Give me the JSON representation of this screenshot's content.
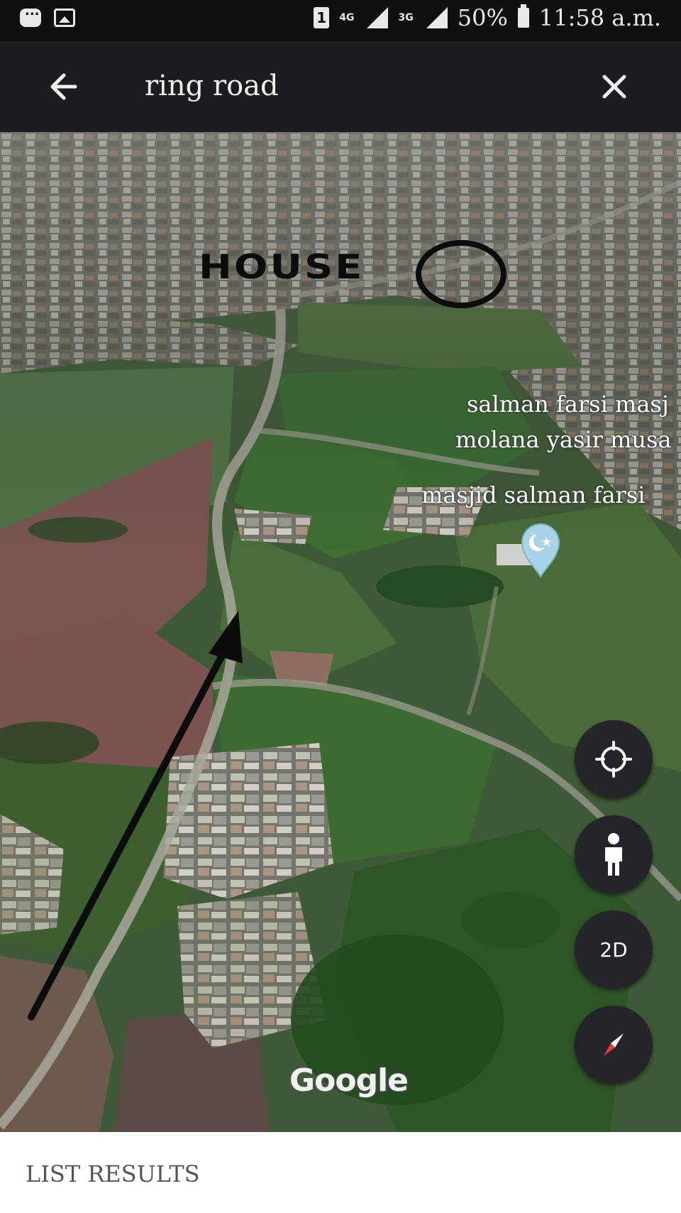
{
  "status_bar": {
    "sim": "1",
    "network_1": "4G",
    "network_2": "3G",
    "battery": "50%",
    "time": "11:58 a.m."
  },
  "app_bar": {
    "query": "ring road",
    "back_icon": "arrow-left-icon",
    "close_icon": "close-icon"
  },
  "map": {
    "annotation_house": "HOUSE",
    "places": [
      {
        "label": "salman farsi masj"
      },
      {
        "label": "molana yasir musa"
      },
      {
        "label": "masjid salman farsi"
      }
    ],
    "attribution": "Google",
    "controls": {
      "locate_icon": "crosshair-icon",
      "streetview_icon": "person-icon",
      "view_mode": "2D",
      "compass_icon": "compass-icon"
    }
  },
  "results": {
    "title": "LIST RESULTS"
  },
  "colors": {
    "app_bar": "#1c1d22",
    "fab": "#23252a",
    "mosque_pin": "#a8d4e6",
    "compass_red": "#e53935"
  }
}
